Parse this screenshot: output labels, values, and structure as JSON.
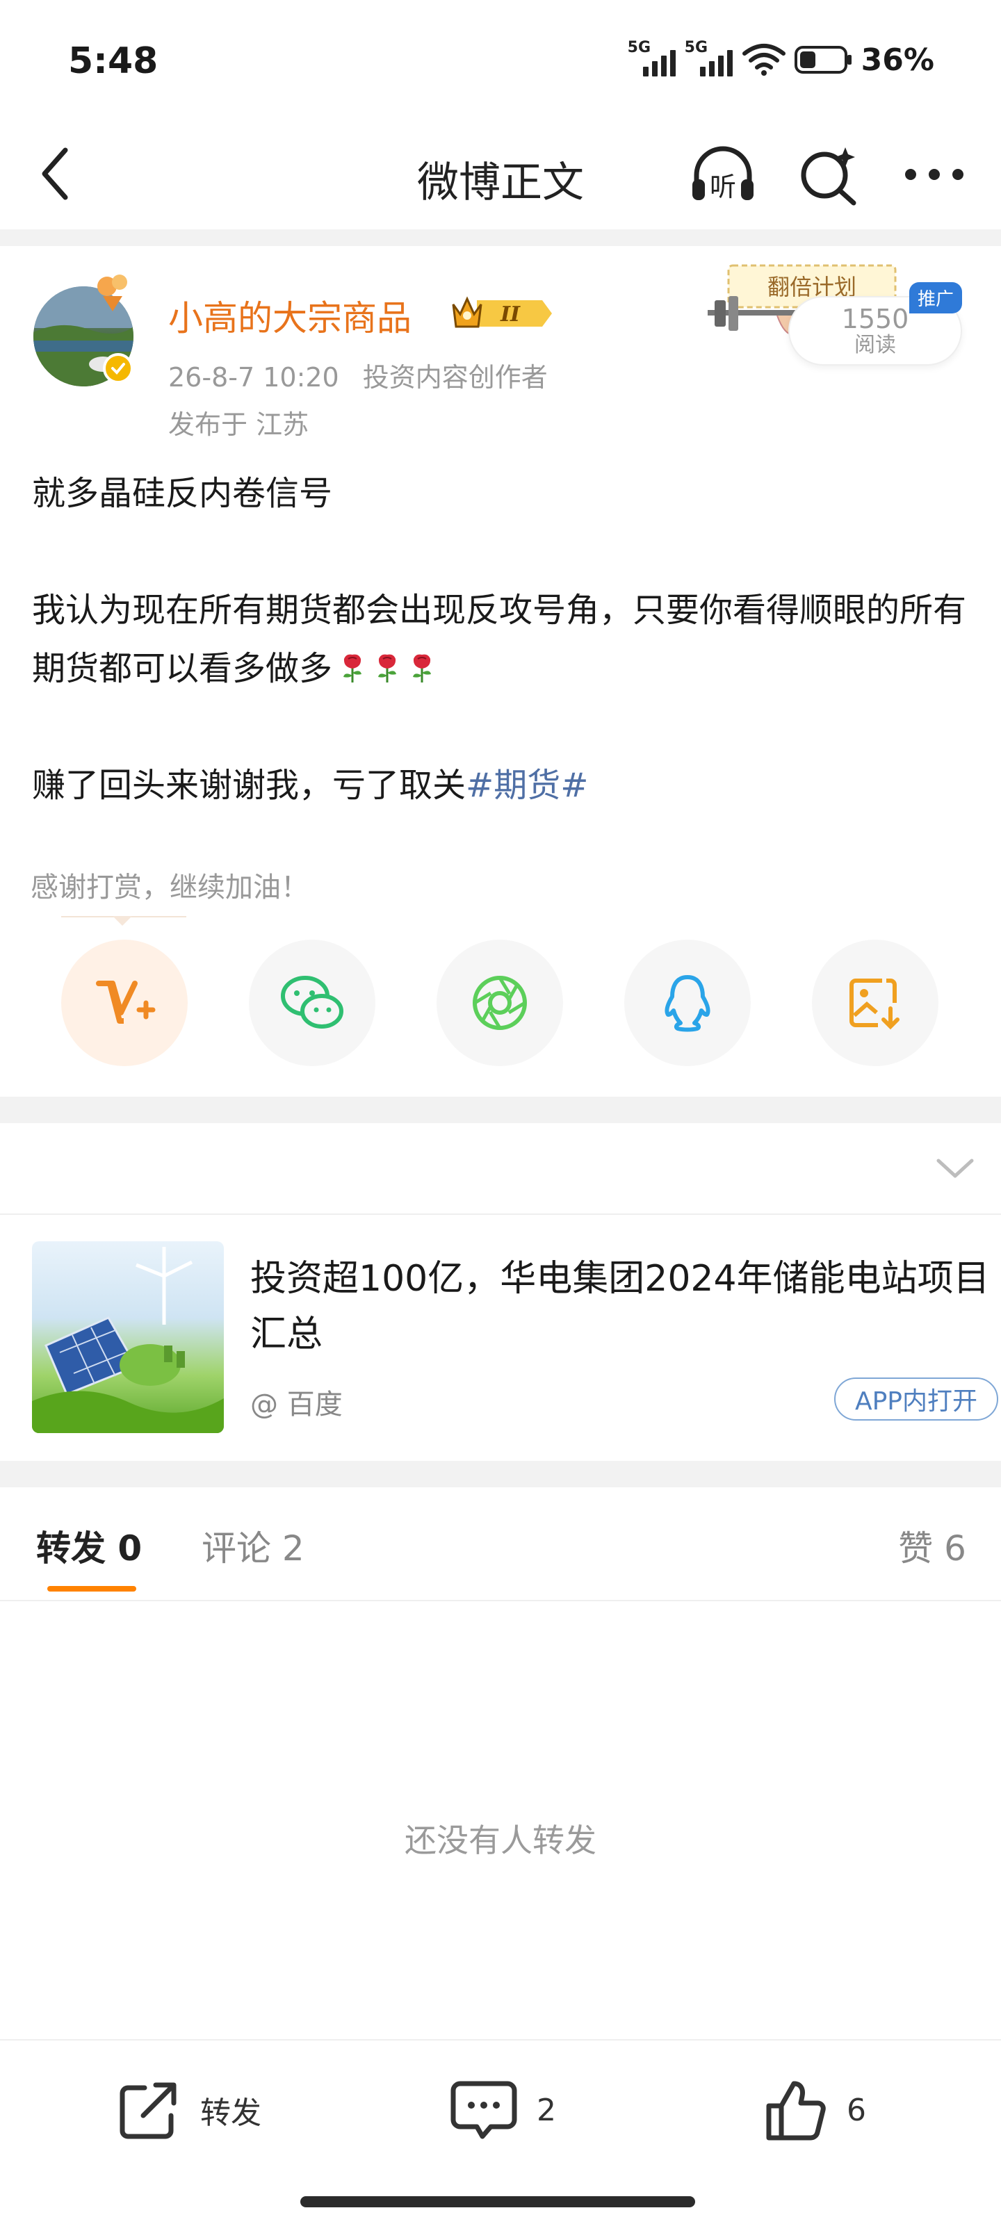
{
  "status_bar": {
    "time": "5:48",
    "signal1_label": "5G",
    "signal2_label": "5G",
    "battery_percent": "36%",
    "battery_level": 0.36
  },
  "nav": {
    "title": "微博正文",
    "listen_label": "听"
  },
  "post": {
    "author": "小高的大宗商品",
    "vip_level": "II",
    "datetime": "26-8-7 10:20",
    "author_tag": "投资内容创作者",
    "location": "发布于 江苏",
    "paragraphs": {
      "p1": "就多晶硅反内卷信号",
      "p2": "我认为现在所有期货都会出现反攻号角，只要你看得顺眼的所有期货都可以看多做多",
      "p3_text": "赚了回头来谢谢我，亏了取关",
      "p3_hashtag": "#期货#"
    },
    "emoji_name": "rose",
    "emoji_count": 3
  },
  "promo": {
    "art_text": "翻倍计划",
    "read_count": "1550",
    "read_label": "阅读",
    "tag": "推广"
  },
  "reward": {
    "text": "感谢打赏，继续加油！"
  },
  "share_icons": [
    "reward-v-plus-icon",
    "wechat-icon",
    "moments-icon",
    "qq-icon",
    "save-image-icon"
  ],
  "ad": {
    "title": "投资超100亿，华电集团2024年储能电站项目汇总",
    "source": "@ 百度",
    "open_label": "APP内打开"
  },
  "tabs": {
    "repost": "转发 0",
    "comment": "评论 2",
    "like": "赞 6"
  },
  "empty_state": "还没有人转发",
  "bottom_bar": {
    "repost_label": "转发",
    "comment_count": "2",
    "like_count": "6"
  },
  "colors": {
    "accent": "#ff8200",
    "username": "#e8731b",
    "hashtag": "#4f6fa5",
    "promo_tag": "#2f7ad8"
  }
}
